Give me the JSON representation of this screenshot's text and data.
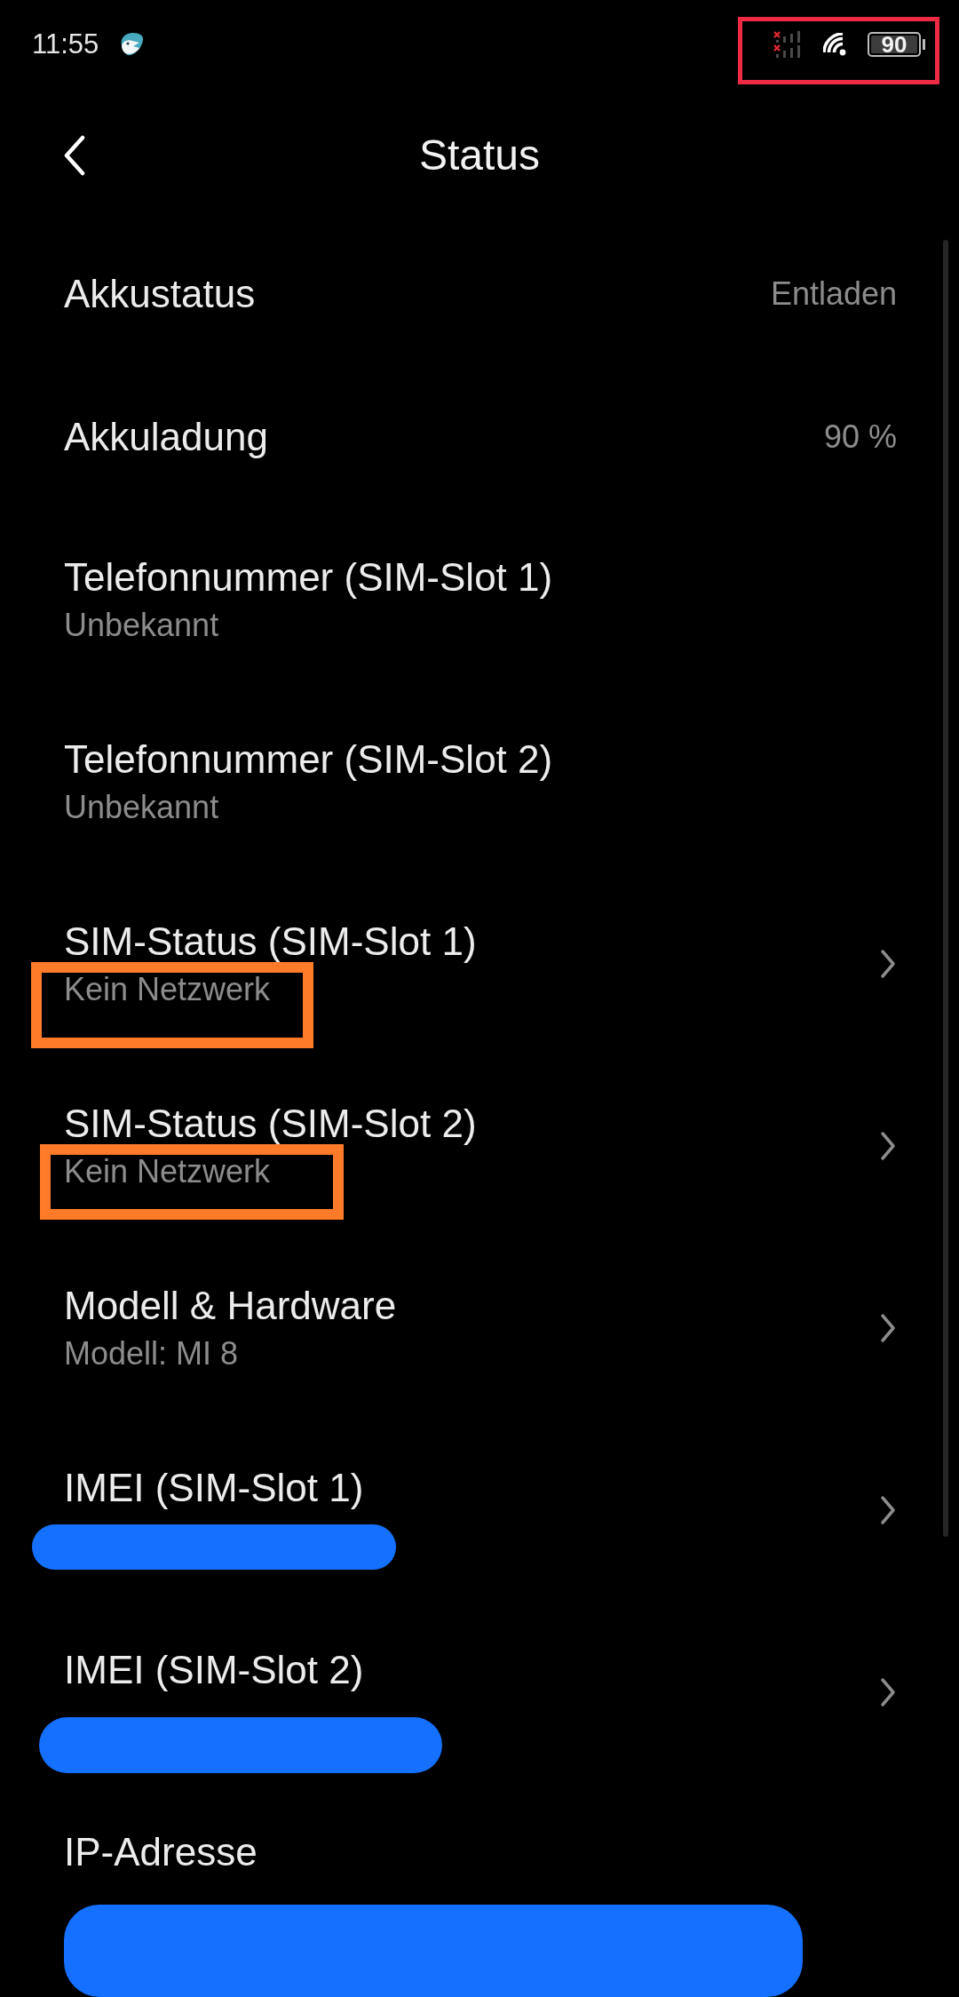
{
  "status_bar": {
    "time": "11:55",
    "battery_text": "90",
    "icons_highlighted": true
  },
  "header": {
    "title": "Status"
  },
  "items": [
    {
      "kind": "inline",
      "label": "Akkustatus",
      "value": "Entladen",
      "chevron": false,
      "highlighted": false,
      "redacted": false
    },
    {
      "kind": "inline",
      "label": "Akkuladung",
      "value": "90 %",
      "chevron": false,
      "highlighted": false,
      "redacted": false
    },
    {
      "kind": "subtitle",
      "label": "Telefonnummer (SIM-Slot 1)",
      "value": "Unbekannt",
      "chevron": false,
      "highlighted": false,
      "redacted": false
    },
    {
      "kind": "subtitle",
      "label": "Telefonnummer (SIM-Slot 2)",
      "value": "Unbekannt",
      "chevron": false,
      "highlighted": false,
      "redacted": false
    },
    {
      "kind": "subtitle",
      "label": "SIM-Status (SIM-Slot 1)",
      "value": "Kein Netzwerk",
      "chevron": true,
      "highlighted": true,
      "redacted": false
    },
    {
      "kind": "subtitle",
      "label": "SIM-Status (SIM-Slot 2)",
      "value": "Kein Netzwerk",
      "chevron": true,
      "highlighted": true,
      "redacted": false
    },
    {
      "kind": "subtitle",
      "label": "Modell & Hardware",
      "value": "Modell: MI 8",
      "chevron": true,
      "highlighted": false,
      "redacted": false
    },
    {
      "kind": "subtitle",
      "label": "IMEI (SIM-Slot 1)",
      "chevron": true,
      "highlighted": false,
      "redacted": true
    },
    {
      "kind": "subtitle",
      "label": "IMEI (SIM-Slot 2)",
      "chevron": true,
      "highlighted": false,
      "redacted": true
    },
    {
      "kind": "subtitle",
      "label": "IP-Adresse",
      "chevron": false,
      "highlighted": false,
      "redacted": true
    }
  ]
}
